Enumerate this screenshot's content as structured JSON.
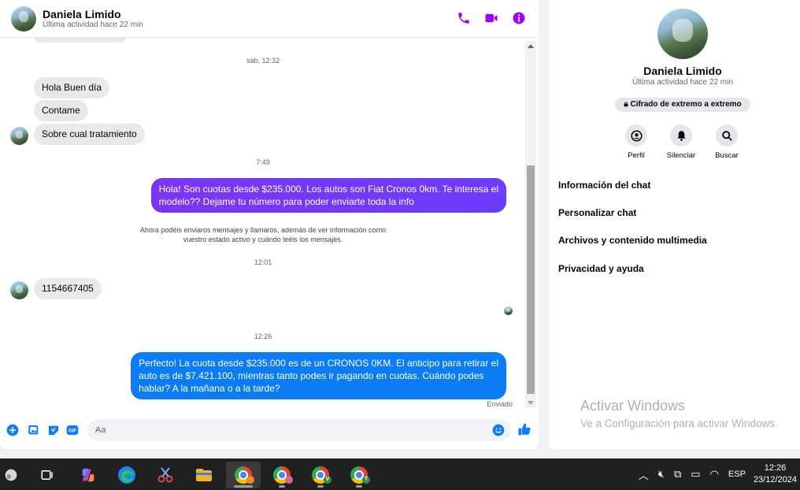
{
  "chat": {
    "contact_name": "Daniela Limido",
    "last_active": "Última actividad hace 22 min",
    "messages": {
      "time_1": "sáb, 12:32",
      "in_1": "Hola Buen día",
      "in_2": "Contame",
      "in_3": "Sobre cual tratamiento",
      "time_2": "7:49",
      "out_1_line1": "Hola! Son cuotas desde $235.000. Los autos son Fiat Cronos 0km. Te interesa el",
      "out_1_line2": "modelo?? Dejame tu número para poder enviarte toda la info",
      "notice_line1": "Ahora podéis enviaros mensajes y llamaros, además de ver información como",
      "notice_line2": "vuestro estado activo y cuándo leéis los mensajes.",
      "time_3": "12:01",
      "in_4": "1154667405",
      "time_4": "12:26",
      "out_2_line1": "Perfecto! La cuota desde $235.000 es de un CRONOS 0KM. El anticipo para retirar el",
      "out_2_line2": "auto es de $7.421.100, mientras tanto podes ir pagando en cuotas. Cuándo podes",
      "out_2_line3": "hablar? A la mañana o a la tarde?",
      "sent_status": "Enviado"
    },
    "composer": {
      "placeholder": "Aa",
      "gif_label": "GIF"
    }
  },
  "info": {
    "name": "Daniela Limido",
    "last_active": "Última actividad hace 22 min",
    "encryption": "Cifrado de extremo a extremo",
    "actions": [
      "Perfil",
      "Silenciar",
      "Buscar"
    ],
    "sections": [
      "Información del chat",
      "Personalizar chat",
      "Archivos y contenido multimedia",
      "Privacidad y ayuda"
    ]
  },
  "watermark": {
    "title": "Activar Windows",
    "subtitle": "Ve a Configuración para activar Windows."
  },
  "taskbar": {
    "language": "ESP",
    "time": "12:26",
    "date": "23/12/2024",
    "badges": [
      "",
      "V",
      "T"
    ]
  },
  "colors": {
    "accent_purple": "#a100ff",
    "bubble_purple": "#7b35f3",
    "bubble_blue": "#0c7cf5",
    "messenger_blue": "#0a7cff"
  }
}
